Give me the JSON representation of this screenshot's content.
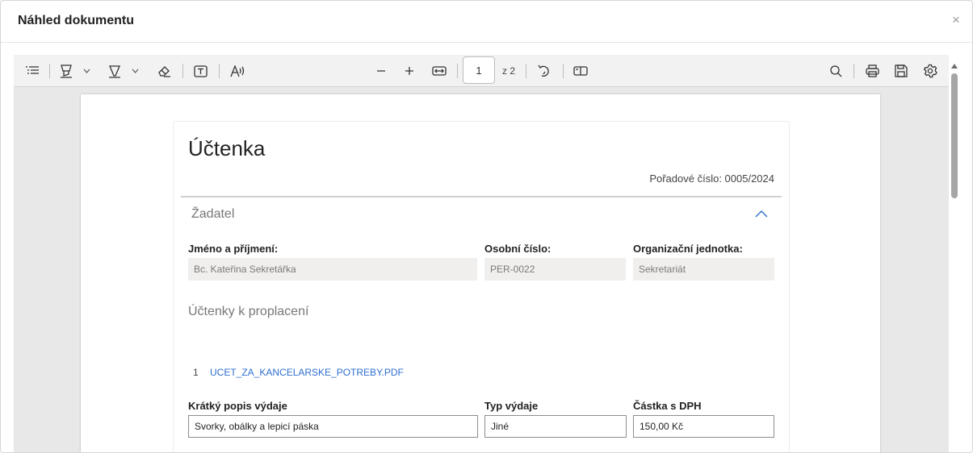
{
  "dialog": {
    "title": "Náhled dokumentu",
    "close_glyph": "×"
  },
  "toolbar": {
    "icons": [
      "outline-list-icon",
      "highlight-icon",
      "draw-icon",
      "eraser-icon",
      "text-box-icon",
      "read-aloud-icon",
      "zoom-out-icon",
      "zoom-in-icon",
      "fit-width-icon",
      "rotate-icon",
      "page-view-icon",
      "search-icon",
      "print-icon",
      "save-icon",
      "settings-icon"
    ],
    "page_current": "1",
    "page_of": "z 2"
  },
  "document": {
    "title": "Účtenka",
    "order_number": "Pořadové číslo: 0005/2024",
    "applicant_section": {
      "title": "Žadatel",
      "fields": [
        {
          "label": "Jméno a příjmení:",
          "value": "Bc. Kateřina Sekretářka"
        },
        {
          "label": "Osobní číslo:",
          "value": "PER-0022"
        },
        {
          "label": "Organizační jednotka:",
          "value": "Sekretariát"
        }
      ]
    },
    "receipts_section": {
      "title": "Účtenky k proplacení",
      "items": [
        {
          "index": "1",
          "file": "UCET_ZA_KANCELARSKE_POTREBY.PDF",
          "fields": [
            {
              "label": "Krátký popis výdaje",
              "value": "Svorky, obálky a lepicí páska"
            },
            {
              "label": "Typ výdaje",
              "value": "Jiné"
            },
            {
              "label": "Částka s DPH",
              "value": "150,00 Kč"
            }
          ]
        }
      ]
    }
  },
  "colors": {
    "link": "#2e6fd0",
    "readonly_field": "#f1efee",
    "viewer_background": "#e8e8e8"
  }
}
